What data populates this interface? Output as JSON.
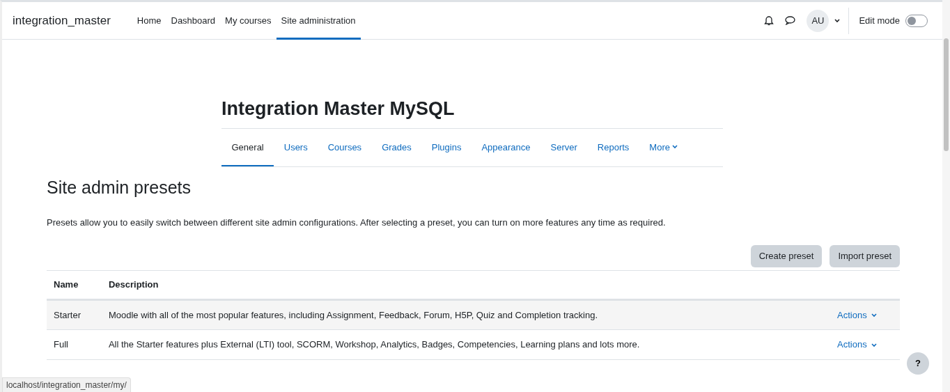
{
  "navbar": {
    "brand": "integration_master",
    "items": [
      {
        "label": "Home",
        "selected": false
      },
      {
        "label": "Dashboard",
        "selected": false
      },
      {
        "label": "My courses",
        "selected": false
      },
      {
        "label": "Site administration",
        "selected": true
      }
    ],
    "avatar": "AU",
    "edit_mode": {
      "label": "Edit mode",
      "on": false
    }
  },
  "heading": "Integration Master MySQL",
  "tabs": [
    {
      "label": "General",
      "selected": true,
      "kind": "tab"
    },
    {
      "label": "Users",
      "selected": false,
      "kind": "tab"
    },
    {
      "label": "Courses",
      "selected": false,
      "kind": "tab"
    },
    {
      "label": "Grades",
      "selected": false,
      "kind": "tab"
    },
    {
      "label": "Plugins",
      "selected": false,
      "kind": "tab"
    },
    {
      "label": "Appearance",
      "selected": false,
      "kind": "tab"
    },
    {
      "label": "Server",
      "selected": false,
      "kind": "tab"
    },
    {
      "label": "Reports",
      "selected": false,
      "kind": "tab"
    },
    {
      "label": "More",
      "selected": false,
      "kind": "dropdown"
    }
  ],
  "page_title": "Site admin presets",
  "intro": "Presets allow you to easily switch between different site admin configurations. After selecting a preset, you can turn on more features any time as required.",
  "buttons": [
    "Create preset",
    "Import preset"
  ],
  "table": {
    "columns": [
      "Name",
      "Description"
    ],
    "rows": [
      {
        "name": "Starter",
        "description": "Moodle with all of the most popular features, including Assignment, Feedback, Forum, H5P, Quiz and Completion tracking.",
        "action": "Actions"
      },
      {
        "name": "Full",
        "description": "All the Starter features plus External (LTI) tool, SCORM, Workshop, Analytics, Badges, Competencies, Learning plans and lots more.",
        "action": "Actions"
      }
    ]
  },
  "help_button": "?",
  "status_bar": "localhost/integration_master/my/"
}
